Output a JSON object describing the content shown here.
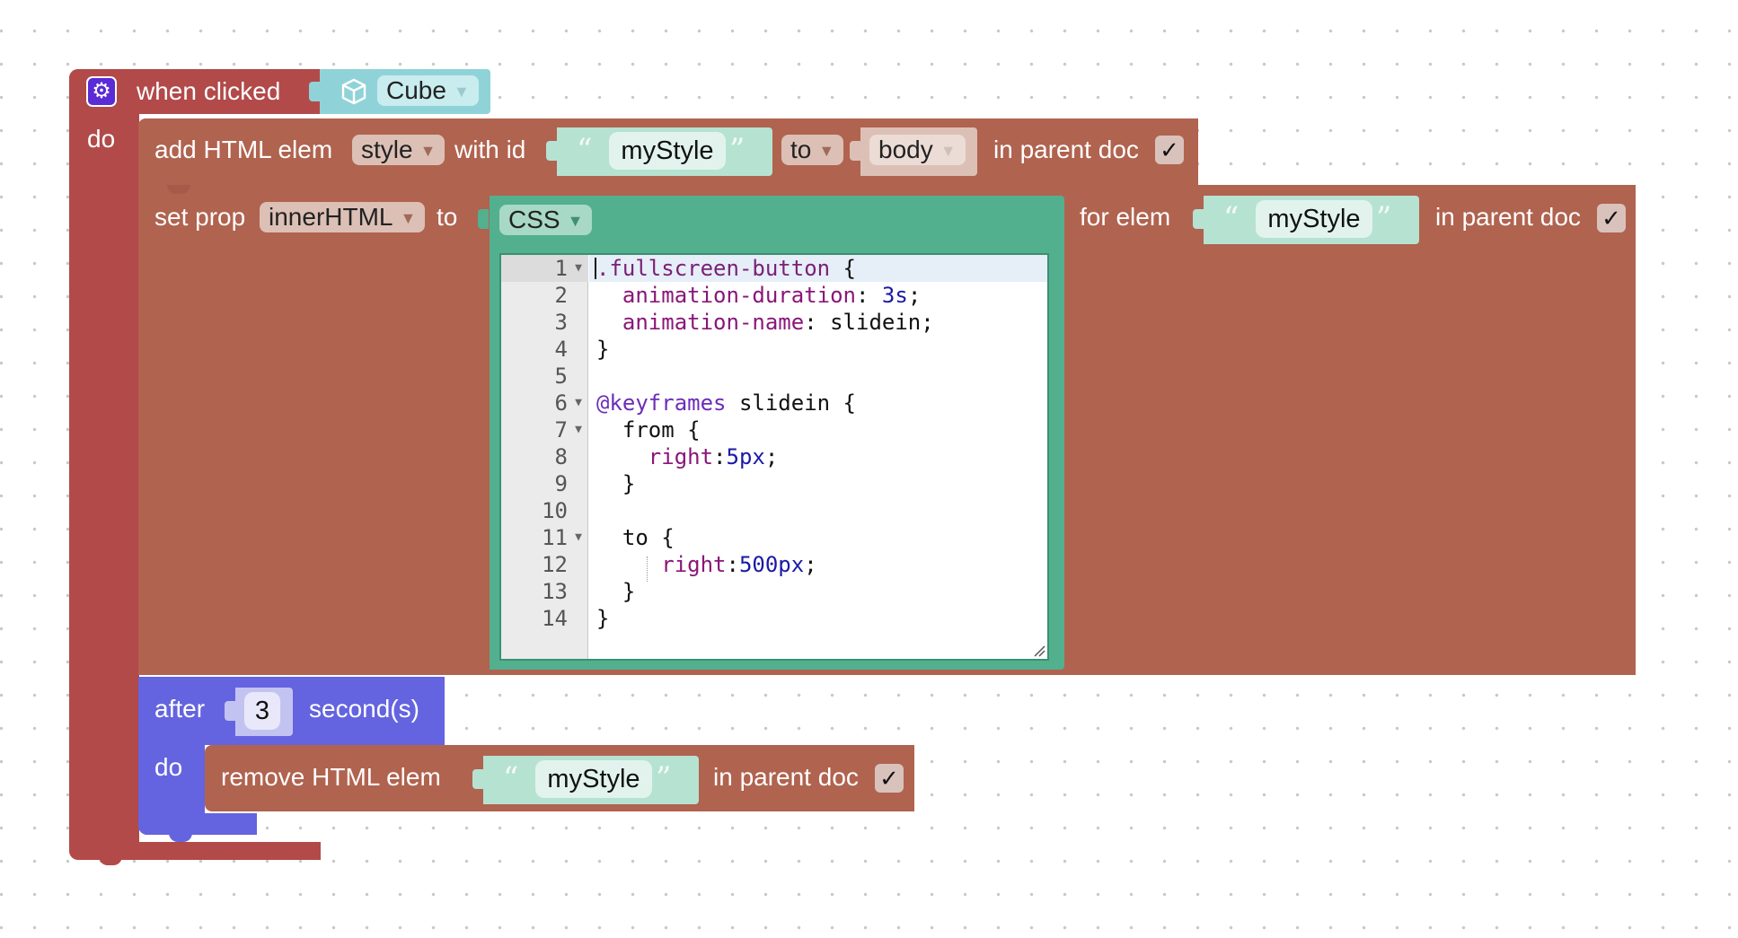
{
  "event_block": {
    "label": "when clicked",
    "object_value": "Cube",
    "do_label": "do",
    "color": "#b24a4a"
  },
  "add_block": {
    "label": "add HTML elem",
    "elem_value": "style",
    "with_id_label": "with id",
    "id_value": "myStyle",
    "to_label": "to",
    "parent_value": "body",
    "parent_doc_label": "in parent doc",
    "check": "✓",
    "color": "#b0634f"
  },
  "set_block": {
    "label": "set prop",
    "prop_value": "innerHTML",
    "to_label": "to",
    "lang_value": "CSS",
    "for_elem_label": "for elem",
    "id_value": "myStyle",
    "parent_doc_label": "in parent doc",
    "check": "✓"
  },
  "code_editor": {
    "line_numbers": [
      "1",
      "2",
      "3",
      "4",
      "5",
      "6",
      "7",
      "8",
      "9",
      "10",
      "11",
      "12",
      "13",
      "14"
    ],
    "lines": [
      ".fullscreen-button {",
      "  animation-duration: 3s;",
      "  animation-name: slidein;",
      "}",
      "",
      "@keyframes slidein {",
      "  from {",
      "    right:5px;",
      "  }",
      "",
      "  to {",
      "     right:500px;",
      "  }",
      "}"
    ],
    "color": "#52b08e"
  },
  "after_block": {
    "label": "after",
    "seconds_value": "3",
    "seconds_label": "second(s)",
    "do_label": "do",
    "color": "#6464e0"
  },
  "remove_block": {
    "label": "remove HTML elem",
    "id_value": "myStyle",
    "parent_doc_label": "in parent doc",
    "check": "✓"
  }
}
